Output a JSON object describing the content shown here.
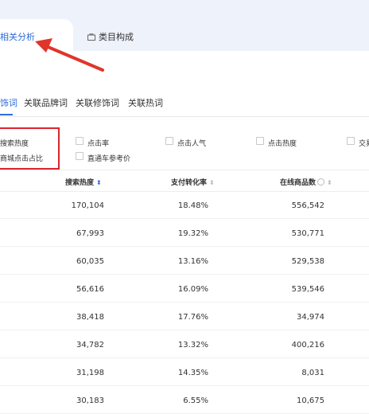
{
  "top_tabs": [
    {
      "label": "相关分析",
      "active": true
    },
    {
      "label": "类目构成",
      "icon": "box-icon"
    }
  ],
  "sub_tabs": [
    {
      "label": "饰词",
      "active": true
    },
    {
      "label": "关联品牌词"
    },
    {
      "label": "关联修饰词"
    },
    {
      "label": "关联热词"
    }
  ],
  "metrics": {
    "row1": [
      {
        "label": "搜索热度",
        "checked": true
      },
      {
        "label": "点击率"
      },
      {
        "label": "点击人气"
      },
      {
        "label": "点击热度"
      },
      {
        "label": "交易"
      }
    ],
    "row2": [
      {
        "label": "商城点击占比",
        "checked": true
      },
      {
        "label": "直通车参考价"
      }
    ]
  },
  "table": {
    "columns": [
      {
        "label": "搜索热度",
        "sort": "desc-active"
      },
      {
        "label": "支付转化率",
        "sort": "none"
      },
      {
        "label": "在线商品数",
        "sort": "none",
        "help": true
      }
    ],
    "rows": [
      [
        "170,104",
        "18.48%",
        "556,542"
      ],
      [
        "67,993",
        "19.32%",
        "530,771"
      ],
      [
        "60,035",
        "13.16%",
        "529,538"
      ],
      [
        "56,616",
        "16.09%",
        "539,546"
      ],
      [
        "38,418",
        "17.76%",
        "34,974"
      ],
      [
        "34,782",
        "13.32%",
        "400,216"
      ],
      [
        "31,198",
        "14.35%",
        "8,031"
      ],
      [
        "30,183",
        "6.55%",
        "10,675"
      ]
    ]
  },
  "colors": {
    "accent": "#2f6bd8",
    "highlight_box": "#d9262c",
    "arrow": "#e0352b",
    "top_background": "#eef2fb"
  }
}
